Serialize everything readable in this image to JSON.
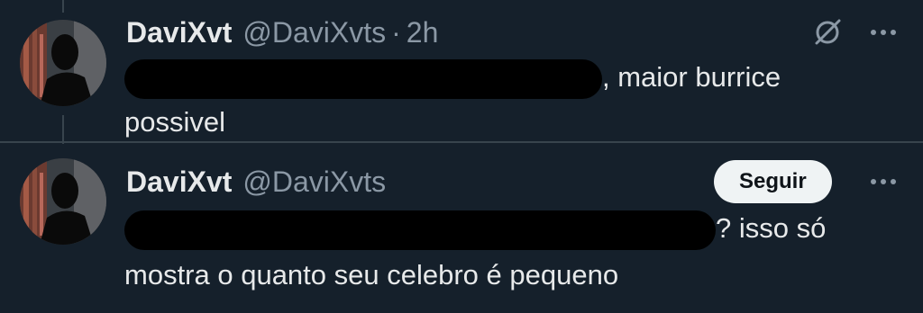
{
  "tweets": [
    {
      "display_name": "DaviXvt",
      "handle": "@DaviXvts",
      "separator": "·",
      "time": "2h",
      "text_line1_after": ", maior burrice",
      "text_line2": "possivel",
      "icons": [
        "grok-icon",
        "more-icon"
      ]
    },
    {
      "display_name": "DaviXvt",
      "handle": "@DaviXvts",
      "follow_label": "Seguir",
      "text_line1_after": "? isso só",
      "text_line2": "mostra o quanto seu celebro é pequeno",
      "icons": [
        "more-icon"
      ]
    }
  ],
  "colors": {
    "background": "#15202b",
    "text": "#e7e9ea",
    "secondary_text": "#8b98a5",
    "divider": "#38444d",
    "button_bg": "#eff3f4",
    "button_text": "#0f1419"
  }
}
